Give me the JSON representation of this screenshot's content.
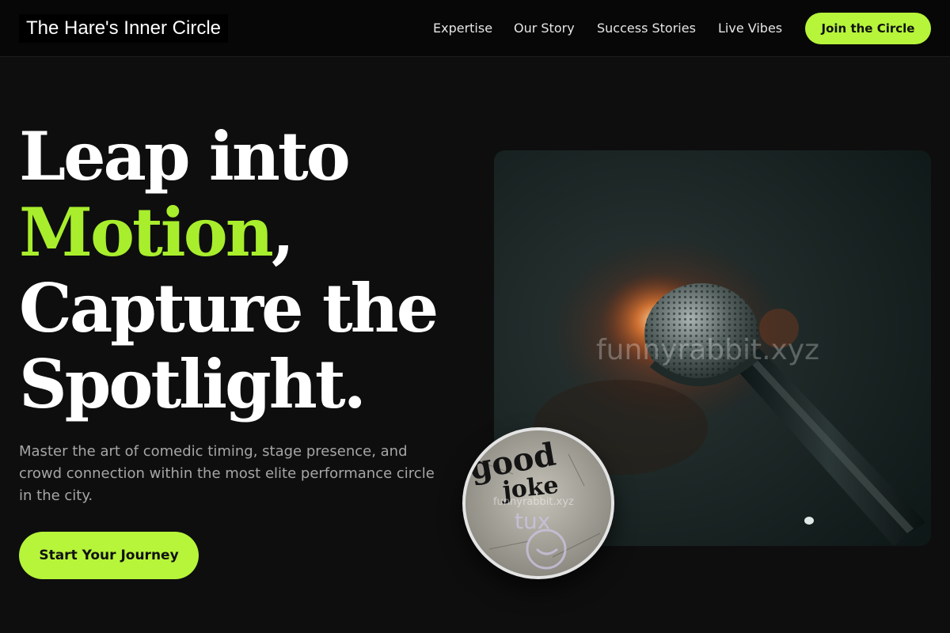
{
  "nav": {
    "brand": "The Hare's Inner Circle",
    "links": [
      {
        "label": "Expertise"
      },
      {
        "label": "Our Story"
      },
      {
        "label": "Success Stories"
      },
      {
        "label": "Live Vibes"
      }
    ],
    "cta_label": "Join the Circle"
  },
  "hero": {
    "headline_part1": "Leap into",
    "headline_accent": "Motion",
    "headline_comma": ",",
    "headline_part2": "Capture the",
    "headline_part3": "Spotlight.",
    "subtext": "Master the art of comedic timing, stage presence, and crowd connection within the most elite performance circle in the city.",
    "cta_label": "Start Your Journey"
  },
  "media": {
    "main_image_icon": "microphone-photo",
    "main_watermark": "funnyrabbit.xyz",
    "inset_image_icon": "good-joke-graffiti-photo",
    "inset_handwriting_line1": "good",
    "inset_handwriting_line2": "joke",
    "inset_handwriting_line3": "tux",
    "inset_watermark": "funnyrabbit.xyz"
  },
  "colors": {
    "background": "#0e0e0e",
    "nav_background": "#070707",
    "accent": "#b6f53a",
    "accent_text": "#a8ee2c",
    "subtext": "#a6a6a6"
  }
}
